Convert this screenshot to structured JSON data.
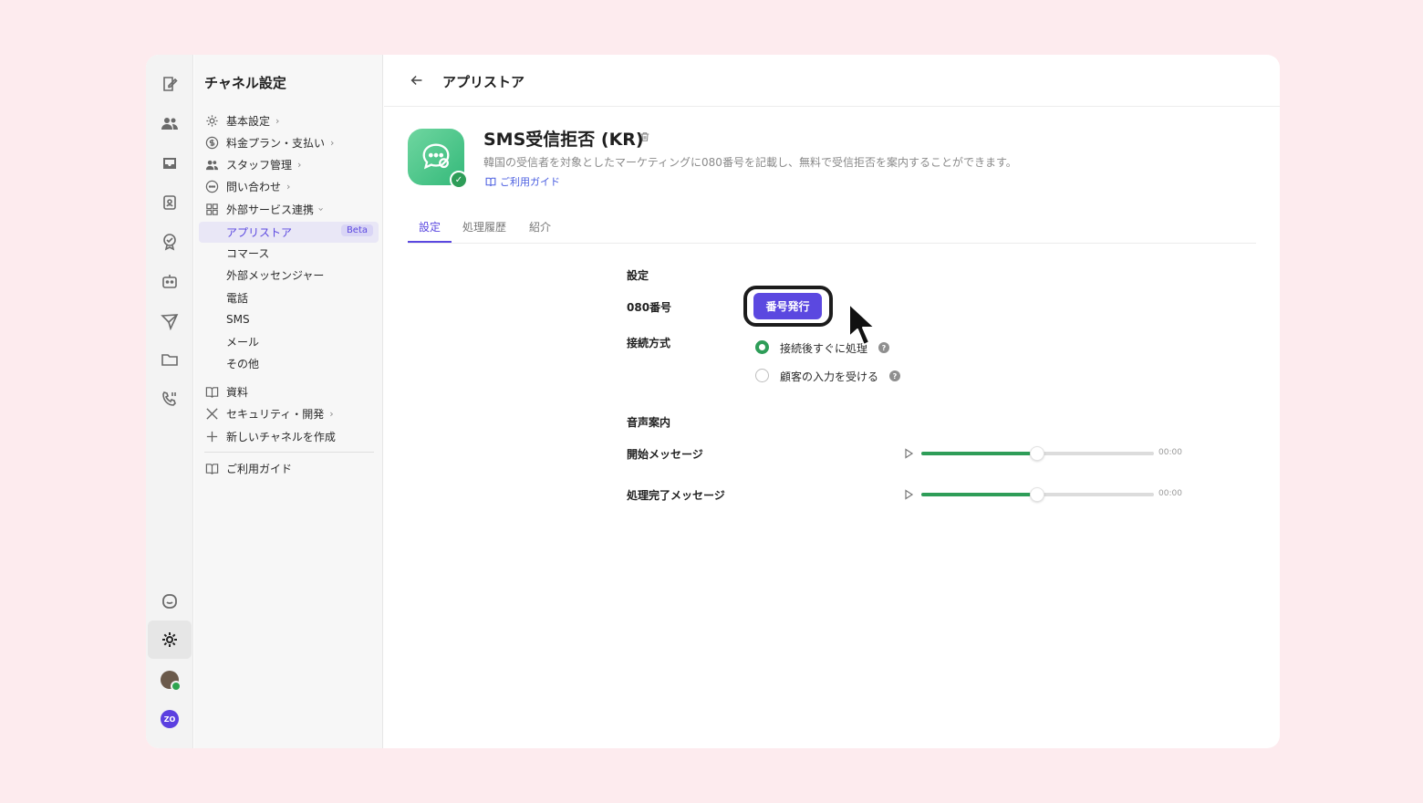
{
  "sidebar": {
    "title": "チャネル設定",
    "items": [
      {
        "label": "基本設定",
        "icon": "gear-icon"
      },
      {
        "label": "料金プラン・支払い",
        "icon": "dollar-icon"
      },
      {
        "label": "スタッフ管理",
        "icon": "users-icon"
      },
      {
        "label": "問い合わせ",
        "icon": "chat-icon"
      },
      {
        "label": "外部サービス連携",
        "icon": "grid-icon"
      }
    ],
    "sub_items": [
      {
        "label": "アプリストア",
        "badge": "Beta"
      },
      {
        "label": "コマース"
      },
      {
        "label": "外部メッセンジャー"
      },
      {
        "label": "電話"
      },
      {
        "label": "SMS"
      },
      {
        "label": "メール"
      },
      {
        "label": "その他"
      }
    ],
    "bottom_items": [
      {
        "label": "資料",
        "icon": "book-icon"
      },
      {
        "label": "セキュリティ・開発",
        "icon": "tools-icon"
      },
      {
        "label": "新しいチャネルを作成",
        "icon": "plus-icon"
      }
    ],
    "guide": "ご利用ガイド"
  },
  "header": {
    "title": "アプリストア"
  },
  "app": {
    "name": "SMS受信拒否 (KR)",
    "description": "韓国の受信者を対象としたマーケティングに080番号を記載し、無料で受信拒否を案内することができます。",
    "guide_link": "ご利用ガイド"
  },
  "tabs": [
    "設定",
    "処理履歴",
    "紹介"
  ],
  "settings": {
    "section_title": "設定",
    "number_label": "080番号",
    "issue_button": "番号発行",
    "connection_label": "接続方式",
    "options": [
      "接続後すぐに処理",
      "顧客の入力を受ける"
    ],
    "selected_option": 0
  },
  "voice": {
    "section_title": "音声案内",
    "rows": [
      {
        "label": "開始メッセージ",
        "time": "00:00",
        "progress": 0.47
      },
      {
        "label": "処理完了メッセージ",
        "time": "00:00",
        "progress": 0.47
      }
    ]
  },
  "colors": {
    "accent": "#5b48e0",
    "success": "#2e9d58",
    "background": "#fdebee"
  }
}
